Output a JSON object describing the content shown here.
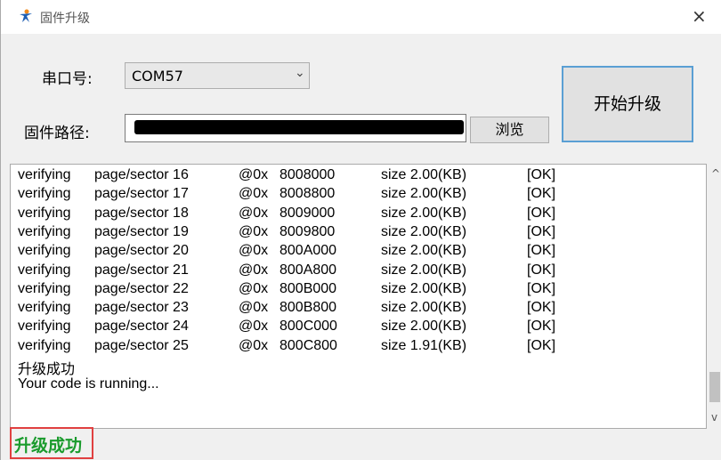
{
  "window": {
    "title": "固件升级",
    "close": "×"
  },
  "form": {
    "port_label": "串口号:",
    "port_value": "COM57",
    "path_label": "固件路径:",
    "browse": "浏览",
    "start": "开始升级"
  },
  "log": {
    "rows": [
      [
        "verifying",
        "page/sector 16",
        "@0x",
        "8008000",
        "size 2.00(KB)",
        "[OK]"
      ],
      [
        "verifying",
        "page/sector 17",
        "@0x",
        "8008800",
        "size 2.00(KB)",
        "[OK]"
      ],
      [
        "verifying",
        "page/sector 18",
        "@0x",
        "8009000",
        "size 2.00(KB)",
        "[OK]"
      ],
      [
        "verifying",
        "page/sector 19",
        "@0x",
        "8009800",
        "size 2.00(KB)",
        "[OK]"
      ],
      [
        "verifying",
        "page/sector 20",
        "@0x",
        "800A000",
        "size 2.00(KB)",
        "[OK]"
      ],
      [
        "verifying",
        "page/sector 21",
        "@0x",
        "800A800",
        "size 2.00(KB)",
        "[OK]"
      ],
      [
        "verifying",
        "page/sector 22",
        "@0x",
        "800B000",
        "size 2.00(KB)",
        "[OK]"
      ],
      [
        "verifying",
        "page/sector 23",
        "@0x",
        "800B800",
        "size 2.00(KB)",
        "[OK]"
      ],
      [
        "verifying",
        "page/sector 24",
        "@0x",
        "800C000",
        "size 2.00(KB)",
        "[OK]"
      ],
      [
        "verifying",
        "page/sector 25",
        "@0x",
        "800C800",
        "size 1.91(KB)",
        "[OK]"
      ]
    ],
    "line_success": "升级成功",
    "line_running": "Your code is running..."
  },
  "status": "升级成功",
  "colors": {
    "status_green": "#1a9b2d",
    "status_border": "#e04040",
    "button_border": "#5a9fd4"
  }
}
